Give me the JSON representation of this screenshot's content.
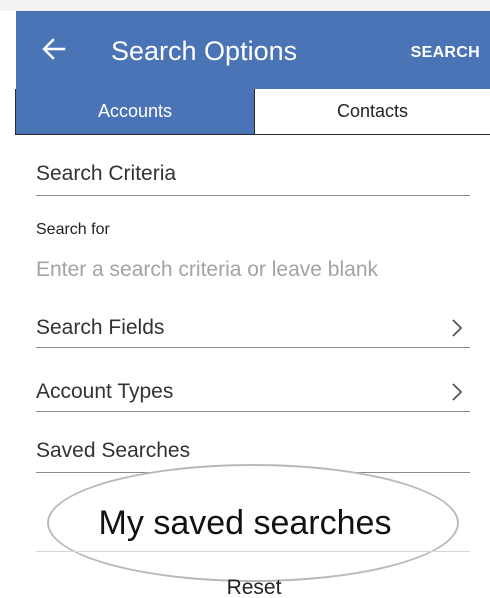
{
  "appbar": {
    "back_icon": "arrow-left-icon",
    "title": "Search Options",
    "action_label": "SEARCH",
    "color": "#4a74b6"
  },
  "tabs": [
    {
      "label": "Accounts",
      "selected": true
    },
    {
      "label": "Contacts",
      "selected": false
    }
  ],
  "form": {
    "search_criteria_heading": "Search Criteria",
    "search_for_label": "Search for",
    "search_for_value": "",
    "search_for_placeholder": "Enter a search criteria or leave blank",
    "search_fields_label": "Search Fields",
    "account_types_label": "Account Types",
    "saved_searches_label": "Saved Searches",
    "saved_searches_value": "My saved searches",
    "chevron_icon": "chevron-right-icon"
  },
  "footer": {
    "reset_label": "Reset"
  }
}
